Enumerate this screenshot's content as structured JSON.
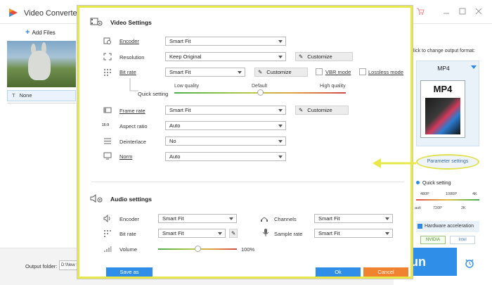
{
  "app": {
    "title": "Video Converter",
    "add_files": "Add Files",
    "file_row_label": "None",
    "output_folder_label": "Output folder:",
    "output_folder_value": "D:\\New f",
    "hint": "lick to change output format:",
    "format": "MP4",
    "format_icon_label": "MP4",
    "parameter_settings": "Parameter settings",
    "quick_setting": "Quick setting",
    "res_top": [
      "480P",
      "1080P",
      "4K"
    ],
    "res_bottom": [
      "ault",
      "720P",
      "2K"
    ],
    "hardware_acceleration": "Hardware acceleration",
    "nvidia": "NVIDIA",
    "intel": "Intel",
    "run_label": "un"
  },
  "video_settings": {
    "title": "Video Settings",
    "encoder": {
      "label": "Encoder",
      "value": "Smart Fit"
    },
    "resolution": {
      "label": "Resolution",
      "value": "Keep Original",
      "customize": "Customize"
    },
    "bit_rate": {
      "label": "Bit rate",
      "value": "Smart Fit",
      "customize": "Customize",
      "vbr": "VBR mode",
      "lossless": "Lossless mode"
    },
    "quick_setting": {
      "label": "Quick setting",
      "low": "Low quality",
      "default": "Default",
      "high": "High quality",
      "level": 0.5
    },
    "frame_rate": {
      "label": "Frame rate",
      "value": "Smart Fit",
      "customize": "Customize"
    },
    "aspect_ratio": {
      "label": "Aspect ratio",
      "value": "Auto",
      "icon_text": "16:9"
    },
    "deinterlace": {
      "label": "Deinterlace",
      "value": "No"
    },
    "norm": {
      "label": "Norm",
      "value": "Auto"
    }
  },
  "audio_settings": {
    "title": "Audio settings",
    "encoder": {
      "label": "Encoder",
      "value": "Smart Fit"
    },
    "bit_rate": {
      "label": "Bit rate",
      "value": "Smart Fit"
    },
    "channels": {
      "label": "Channels",
      "value": "Smart Fit"
    },
    "sample_rate": {
      "label": "Sample rate",
      "value": "Smart Fit"
    },
    "volume": {
      "label": "Volume",
      "value": "100%",
      "level": 0.5
    }
  },
  "buttons": {
    "save_as": "Save as",
    "ok": "Ok",
    "cancel": "Cancel"
  },
  "colors": {
    "accent": "#2f8fe8",
    "cancel": "#f08330",
    "highlight": "#e8e84a"
  }
}
